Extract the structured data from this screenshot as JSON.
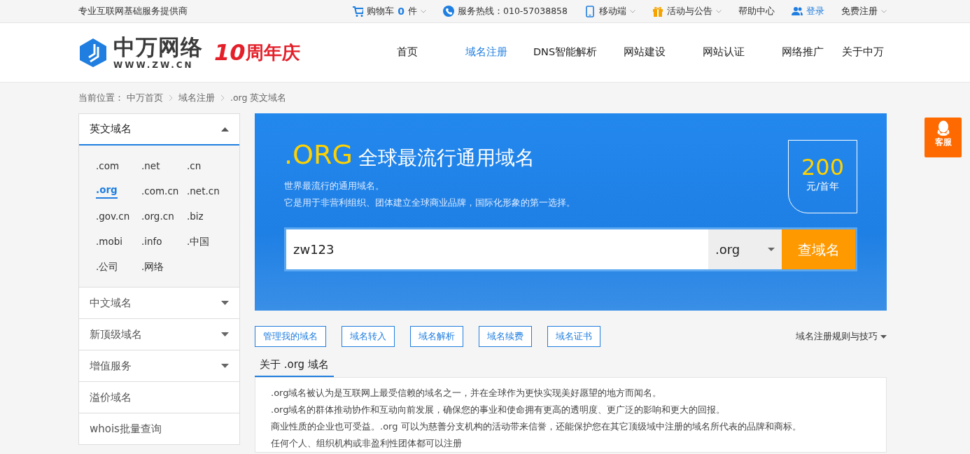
{
  "top_bar": {
    "tagline": "专业互联网基础服务提供商",
    "items": [
      {
        "kind": "cart",
        "label": "购物车",
        "count": "0",
        "unit": "件",
        "dropdown": true
      },
      {
        "kind": "phone",
        "label": "服务热线：010-57038858",
        "dropdown": false
      },
      {
        "kind": "mobile",
        "label": "移动端",
        "dropdown": true
      },
      {
        "kind": "gift",
        "label": "活动与公告",
        "dropdown": true
      },
      {
        "kind": "plain",
        "label": "帮助中心",
        "dropdown": false
      },
      {
        "kind": "login",
        "label": "登录",
        "dropdown": false
      },
      {
        "kind": "plain",
        "label": "免费注册",
        "dropdown": true
      }
    ]
  },
  "header": {
    "logo": {
      "name": "中万网络",
      "url": "WWW.ZW.CN",
      "anniversary_number": "10",
      "anniversary_text": "周年庆"
    },
    "nav": [
      {
        "label": "首页",
        "selected": false
      },
      {
        "label": "域名注册",
        "selected": true
      },
      {
        "label": "DNS智能解析",
        "selected": false
      },
      {
        "label": "网站建设",
        "selected": false
      },
      {
        "label": "网站认证",
        "selected": false
      },
      {
        "label": "网络推广",
        "selected": false
      },
      {
        "label": "关于中万",
        "selected": false
      }
    ]
  },
  "breadcrumb": {
    "label": "当前位置：",
    "items": [
      "中万首页",
      "域名注册",
      ".org 英文域名"
    ]
  },
  "sidebar": [
    {
      "label": "英文域名",
      "expanded": true,
      "domains": [
        {
          "label": ".com",
          "selected": false
        },
        {
          "label": ".net",
          "selected": false
        },
        {
          "label": ".cn",
          "selected": false
        },
        {
          "label": ".org",
          "selected": true
        },
        {
          "label": ".com.cn",
          "selected": false
        },
        {
          "label": ".net.cn",
          "selected": false
        },
        {
          "label": ".gov.cn",
          "selected": false
        },
        {
          "label": ".org.cn",
          "selected": false
        },
        {
          "label": ".biz",
          "selected": false
        },
        {
          "label": ".mobi",
          "selected": false
        },
        {
          "label": ".info",
          "selected": false
        },
        {
          "label": ".中国",
          "selected": false
        },
        {
          "label": ".公司",
          "selected": false
        },
        {
          "label": ".网络",
          "selected": false
        }
      ]
    },
    {
      "label": "中文域名",
      "expanded": false
    },
    {
      "label": "新顶级域名",
      "expanded": false
    },
    {
      "label": "增值服务",
      "expanded": false
    },
    {
      "label": "溢价域名"
    },
    {
      "label": "whois批量查询"
    }
  ],
  "banner": {
    "tld": ".ORG",
    "title": "全球最流行通用域名",
    "lines": [
      "世界最流行的通用域名。",
      "它是用于非营利组织、团体建立全球商业品牌，国际化形象的第一选择。"
    ],
    "price": "200",
    "price_unit": "元/首年",
    "search": {
      "value": "zw123",
      "suffix": ".org",
      "button": "查域名"
    }
  },
  "actions": [
    "管理我的域名",
    "域名转入",
    "域名解析",
    "域名续费",
    "域名证书"
  ],
  "tips_link": "域名注册规则与技巧",
  "about": {
    "tab": "关于 .org 域名",
    "paragraphs": [
      ".org域名被认为是互联网上最受信赖的域名之一，并在全球作为更快实现美好愿望的地方而闻名。",
      ".org域名的群体推动协作和互动向前发展，确保您的事业和使命拥有更高的透明度、更广泛的影响和更大的回报。",
      "商业性质的企业也可受益。.org 可以为慈善分支机构的活动带来信誉，还能保护您在其它顶级域中注册的域名所代表的品牌和商标。",
      "任何个人、组织机构或非盈利性团体都可以注册"
    ]
  },
  "service": {
    "label": "客服"
  }
}
